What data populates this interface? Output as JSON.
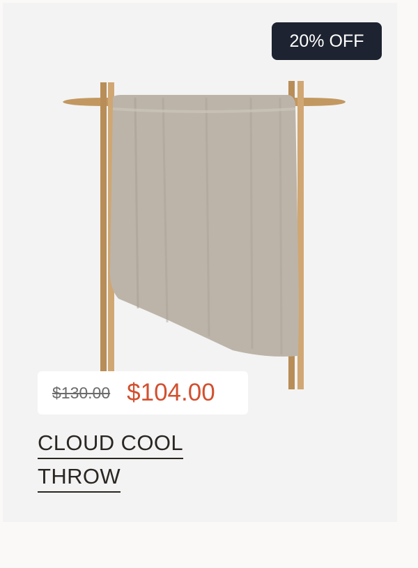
{
  "badge": {
    "label": "20% OFF"
  },
  "price": {
    "original": "$130.00",
    "sale": "$104.00"
  },
  "product": {
    "title_lines": [
      "CLOUD COOL",
      "THROW"
    ]
  },
  "colors": {
    "badge_bg": "#1d2330",
    "sale_price": "#d2502f",
    "card_bg": "#f3f3f3",
    "throw": "#bdb5ab",
    "wood": "#c9a06a"
  }
}
